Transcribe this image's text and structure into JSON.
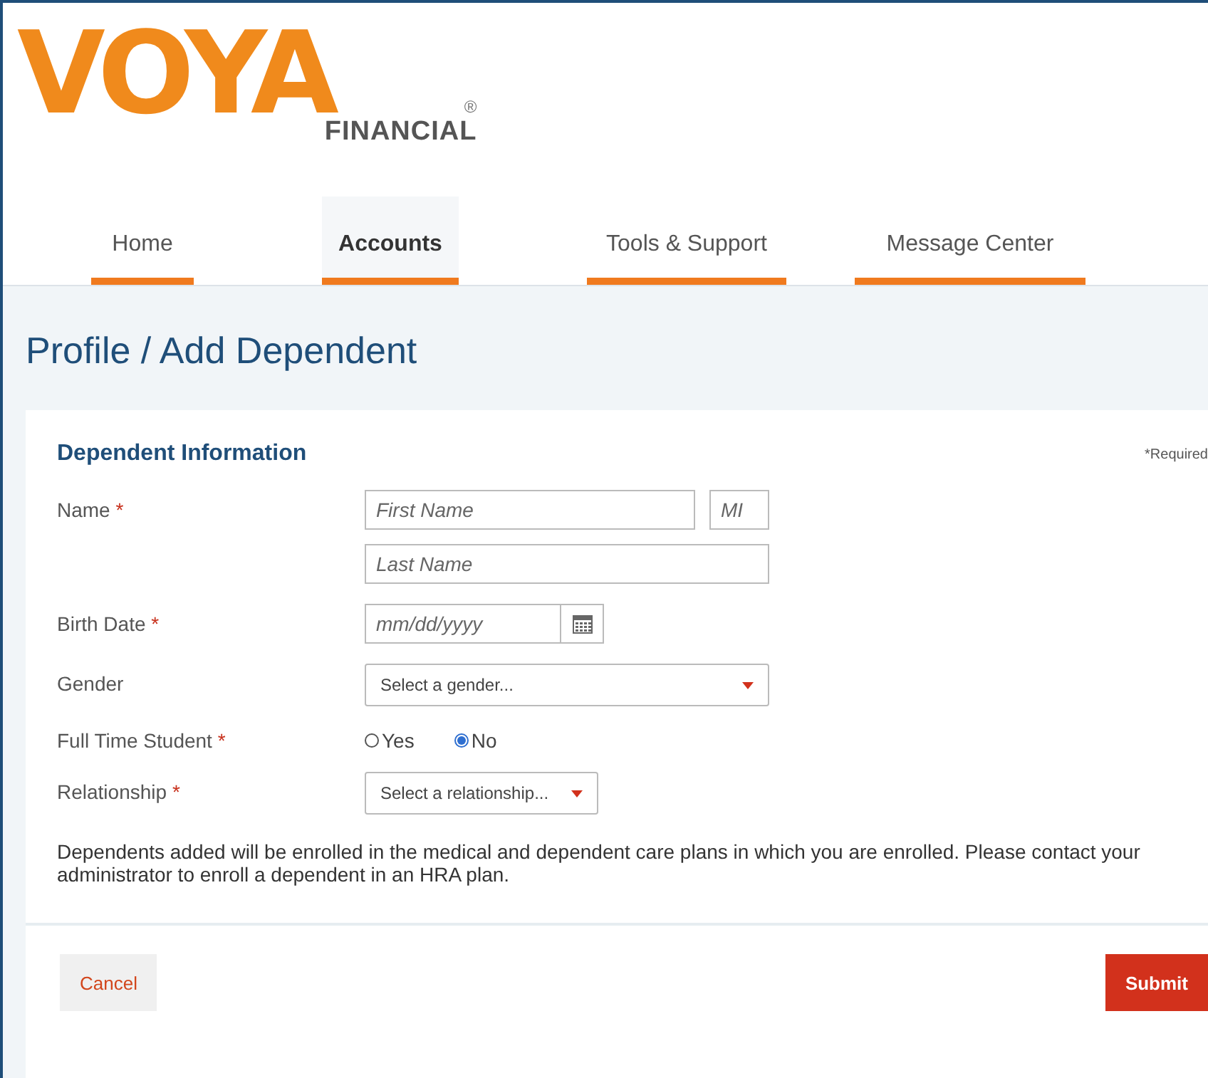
{
  "logo": {
    "wordmark": "VOYA",
    "registered": "®",
    "subtitle": "FINANCIAL"
  },
  "nav": [
    {
      "label": "Home",
      "selected": false
    },
    {
      "label": "Accounts",
      "selected": true
    },
    {
      "label": "Tools & Support",
      "selected": false
    },
    {
      "label": "Message Center",
      "selected": false
    }
  ],
  "page_title": "Profile / Add Dependent",
  "section_title": "Dependent Information",
  "required_note": "*Required",
  "fields": [
    {
      "label": "Name",
      "required_mark": "*",
      "kind": "name",
      "inputs": [
        {
          "placeholder": "First Name"
        },
        {
          "placeholder": "MI"
        },
        {
          "placeholder": "Last Name"
        }
      ]
    },
    {
      "label": "Birth Date",
      "required_mark": "*",
      "kind": "date",
      "inputs": [
        {
          "placeholder": "mm/dd/yyyy"
        }
      ]
    },
    {
      "label": "Gender",
      "kind": "select",
      "value": "Select a gender..."
    },
    {
      "label": "Full Time Student",
      "required_mark": "*",
      "kind": "radio",
      "options": [
        {
          "label": "Yes",
          "selected": false
        },
        {
          "label": "No",
          "selected": true
        }
      ]
    },
    {
      "label": "Relationship",
      "required_mark": "*",
      "kind": "select-short",
      "value": "Select a relationship..."
    }
  ],
  "notice": "Dependents added will be enrolled in the medical and dependent care plans in which you are enrolled. Please contact your administrator to enroll a dependent in an HRA plan.",
  "buttons": [
    {
      "label": "Cancel",
      "kind": "secondary"
    },
    {
      "label": "Submit",
      "kind": "primary"
    }
  ]
}
